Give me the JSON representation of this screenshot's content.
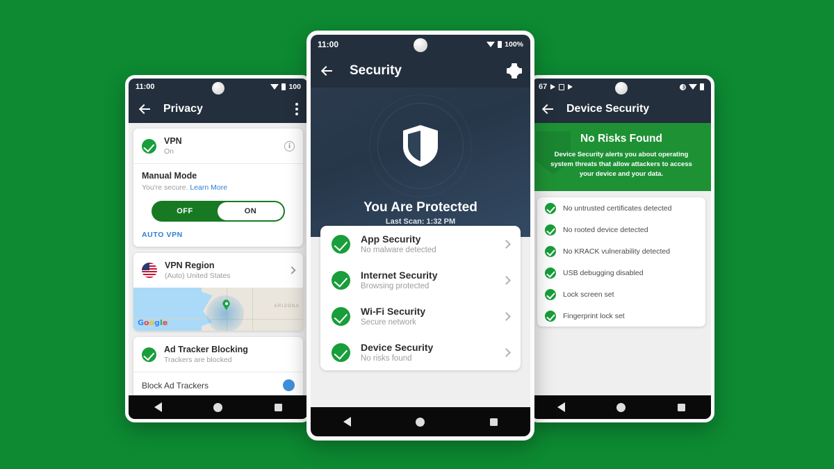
{
  "background": {
    "color": "#0d8a32"
  },
  "phones": {
    "left": {
      "status": {
        "time": "11:00",
        "battery": "100",
        "wifi_icon": "wifi-icon",
        "battery_icon": "battery-icon"
      },
      "appbar": {
        "title": "Privacy",
        "back_icon": "back-arrow-icon",
        "overflow_icon": "overflow-menu-icon"
      },
      "vpn": {
        "name": "VPN",
        "state": "On",
        "info_icon": "info-icon",
        "status_icon": "check-circle-icon"
      },
      "manual": {
        "title": "Manual Mode",
        "desc": "You're secure.",
        "link": "Learn More",
        "toggle": {
          "off_label": "OFF",
          "on_label": "ON",
          "selected": "ON"
        },
        "auto_label": "AUTO VPN"
      },
      "region": {
        "title": "VPN Region",
        "value": "(Auto) United States",
        "flag_icon": "us-flag-icon",
        "chevron_icon": "chevron-right-icon",
        "map": {
          "region_label": "ARIZONA",
          "attribution": "Google",
          "pin_icon": "map-pin-icon"
        }
      },
      "adtracker": {
        "title": "Ad Tracker Blocking",
        "sub": "Trackers are blocked",
        "status_icon": "check-circle-icon",
        "switch_label": "Block Ad Trackers"
      },
      "nav": {
        "back_icon": "nav-back-icon",
        "home_icon": "nav-home-icon",
        "recents_icon": "nav-recents-icon"
      }
    },
    "center": {
      "status": {
        "time": "11:00",
        "battery": "100%",
        "wifi_icon": "wifi-icon",
        "battery_icon": "battery-icon"
      },
      "appbar": {
        "title": "Security",
        "back_icon": "back-arrow-icon",
        "settings_icon": "gear-icon"
      },
      "hero": {
        "shield_icon": "shield-icon",
        "headline": "You Are Protected",
        "last_scan": "Last Scan: 1:32 PM"
      },
      "items": [
        {
          "title": "App Security",
          "sub": "No malware detected",
          "status_icon": "check-circle-icon",
          "chevron_icon": "chevron-right-icon"
        },
        {
          "title": "Internet Security",
          "sub": "Browsing protected",
          "status_icon": "check-circle-icon",
          "chevron_icon": "chevron-right-icon"
        },
        {
          "title": "Wi-Fi Security",
          "sub": "Secure network",
          "status_icon": "check-circle-icon",
          "chevron_icon": "chevron-right-icon"
        },
        {
          "title": "Device Security",
          "sub": "No risks found",
          "status_icon": "check-circle-icon",
          "chevron_icon": "chevron-right-icon"
        }
      ],
      "nav": {
        "back_icon": "nav-back-icon",
        "home_icon": "nav-home-icon",
        "recents_icon": "nav-recents-icon"
      }
    },
    "right": {
      "status": {
        "time": "67",
        "cast_icon": "cast-icon",
        "sim_icon": "sim-icon",
        "play_icon": "play-icon",
        "dnd_icon": "half-circle-icon",
        "wifi_icon": "wifi-icon",
        "battery_icon": "battery-icon"
      },
      "appbar": {
        "title": "Device Security",
        "back_icon": "back-arrow-icon"
      },
      "banner": {
        "title": "No Risks Found",
        "desc": "Device Security alerts you about operating system threats that allow attackers to access your device and your data.",
        "watermark_icon": "shield-watermark-icon"
      },
      "checks": [
        {
          "label": "No untrusted certificates detected",
          "icon": "check-circle-icon"
        },
        {
          "label": "No rooted device detected",
          "icon": "check-circle-icon"
        },
        {
          "label": "No KRACK vulnerability detected",
          "icon": "check-circle-icon"
        },
        {
          "label": "USB debugging disabled",
          "icon": "check-circle-icon"
        },
        {
          "label": "Lock screen set",
          "icon": "check-circle-icon"
        },
        {
          "label": "Fingerprint lock set",
          "icon": "check-circle-icon"
        }
      ],
      "nav": {
        "back_icon": "nav-back-icon",
        "home_icon": "nav-home-icon",
        "recents_icon": "nav-recents-icon"
      }
    }
  }
}
